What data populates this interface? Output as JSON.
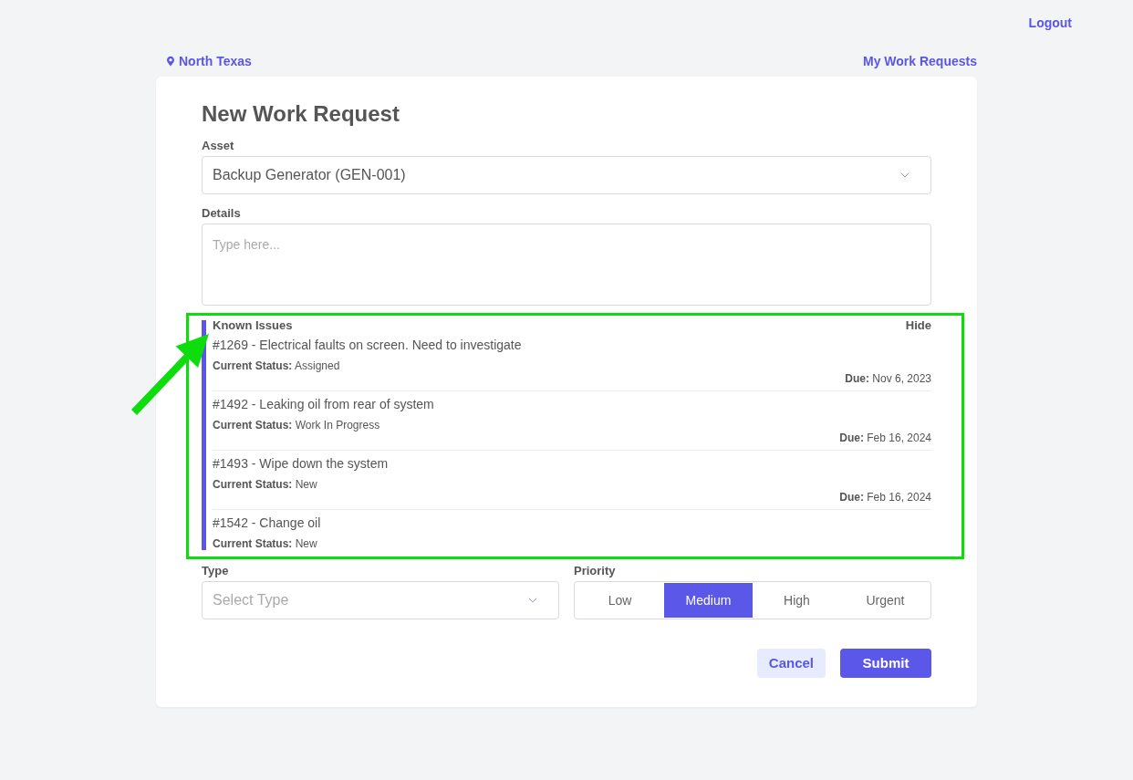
{
  "header": {
    "logout": "Logout"
  },
  "nav": {
    "location": "North Texas",
    "my_requests": "My Work Requests"
  },
  "form": {
    "title": "New Work Request",
    "asset": {
      "label": "Asset",
      "value": "Backup Generator (GEN-001)"
    },
    "details": {
      "label": "Details",
      "placeholder": "Type here..."
    },
    "known_issues": {
      "title": "Known Issues",
      "toggle": "Hide",
      "items": [
        {
          "title": "#1269 - Electrical faults on screen. Need to investigate",
          "status": "**Current Status:** Assigned",
          "due": "**Due:** Nov 6, 2023"
        },
        {
          "title": "#1492 - Leaking oil from rear of system",
          "status": "**Current Status:** Work In Progress",
          "due": "**Due:** Feb 16, 2024"
        },
        {
          "title": "#1493 - Wipe down the system",
          "status": "**Current Status:** New",
          "due": "**Due:** Feb 16, 2024"
        },
        {
          "title": "#1542 - Change oil",
          "status": "**Current Status:** New"
        }
      ]
    },
    "type": {
      "label": "Type",
      "placeholder": "Select Type"
    },
    "priority": {
      "label": "Priority",
      "options": [
        {
          "label": "Low",
          "selected": false
        },
        {
          "label": "Medium",
          "selected": true
        },
        {
          "label": "High",
          "selected": false
        },
        {
          "label": "Urgent",
          "selected": false
        }
      ]
    },
    "buttons": [
      {
        "label": "Cancel",
        "kind": "secondary"
      },
      {
        "label": "Submit",
        "kind": "primary"
      }
    ]
  }
}
